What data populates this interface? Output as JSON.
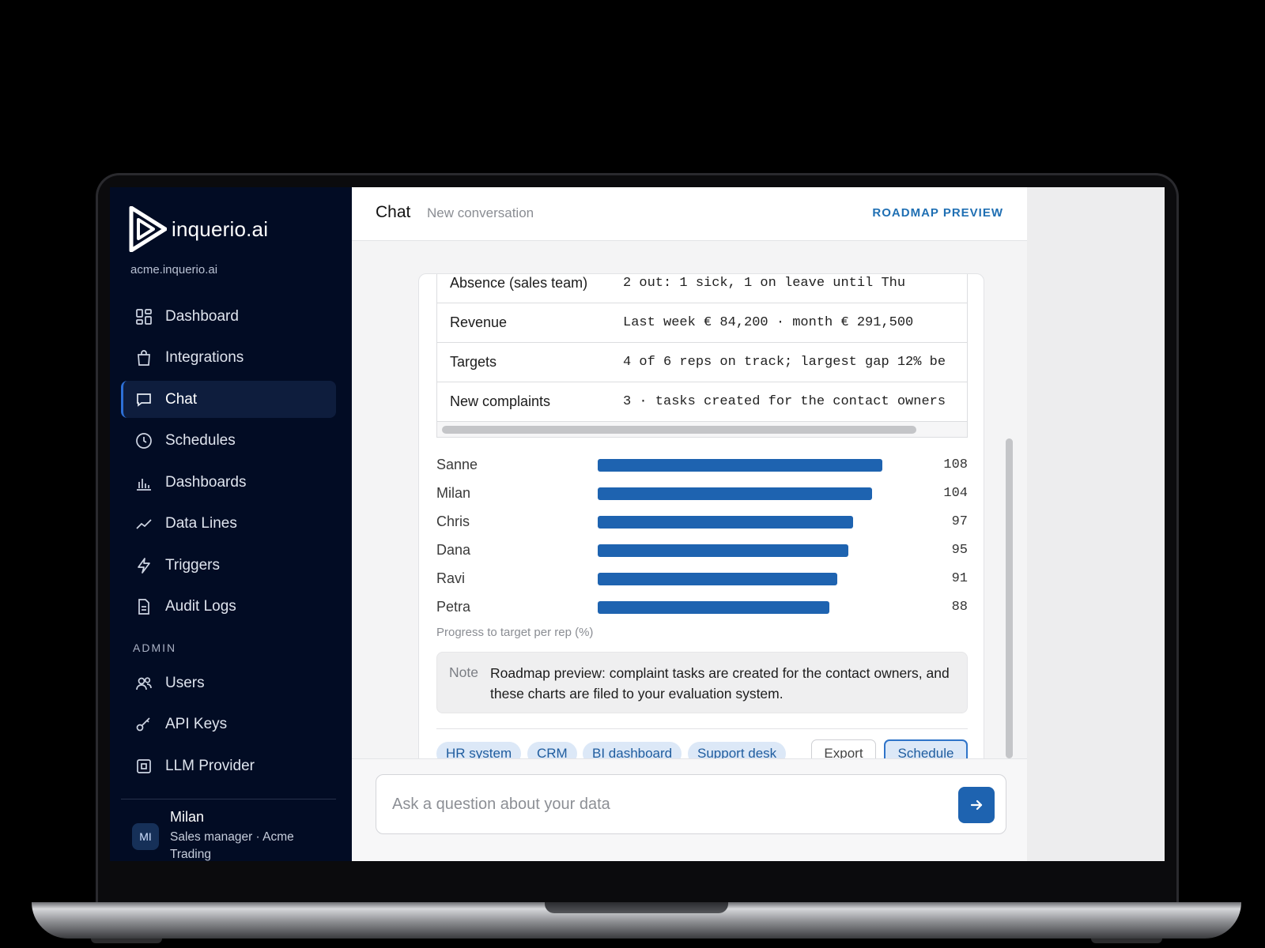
{
  "app": {
    "brand": "inquerio.ai",
    "workspace": "acme.inquerio.ai"
  },
  "sidebar": {
    "items": [
      {
        "label": "Dashboard",
        "icon": "grid-icon"
      },
      {
        "label": "Integrations",
        "icon": "shopping-bag-icon"
      },
      {
        "label": "Chat",
        "icon": "chat-bubble-icon",
        "active": true
      },
      {
        "label": "Schedules",
        "icon": "clock-icon"
      },
      {
        "label": "Dashboards",
        "icon": "bar-chart-icon"
      },
      {
        "label": "Data Lines",
        "icon": "trend-line-icon"
      },
      {
        "label": "Triggers",
        "icon": "lightning-icon"
      },
      {
        "label": "Audit Logs",
        "icon": "document-icon"
      }
    ],
    "admin_label": "ADMIN",
    "admin_items": [
      {
        "label": "Users",
        "icon": "users-icon"
      },
      {
        "label": "API Keys",
        "icon": "key-icon"
      },
      {
        "label": "LLM Provider",
        "icon": "chip-icon"
      }
    ],
    "user": {
      "initials": "MI",
      "name": "Milan",
      "role": "Sales manager · Acme Trading"
    }
  },
  "header": {
    "title": "Chat",
    "subtitle": "New conversation",
    "badge": "ROADMAP PREVIEW"
  },
  "summary_table": [
    {
      "key": "Absence (sales team)",
      "value": "2 out: 1 sick, 1 on leave until Thu"
    },
    {
      "key": "Revenue",
      "value": "Last week € 84,200 · month € 291,500"
    },
    {
      "key": "Targets",
      "value": "4 of 6 reps on track; largest gap 12% be"
    },
    {
      "key": "New complaints",
      "value": "3 · tasks created for the contact owners"
    }
  ],
  "chart_data": {
    "type": "bar",
    "orientation": "horizontal",
    "categories": [
      "Sanne",
      "Milan",
      "Chris",
      "Dana",
      "Ravi",
      "Petra"
    ],
    "values": [
      108,
      104,
      97,
      95,
      91,
      88
    ],
    "caption": "Progress to target per rep (%)",
    "xlim": [
      0,
      120
    ],
    "color": "#1e63b0"
  },
  "note": {
    "label": "Note",
    "text": "Roadmap preview: complaint tasks are created for the contact owners, and these charts are filed to your evaluation system."
  },
  "chips": [
    "HR system",
    "CRM",
    "BI dashboard",
    "Support desk"
  ],
  "actions": {
    "export": "Export",
    "schedule": "Schedule"
  },
  "composer": {
    "placeholder": "Ask a question about your data"
  }
}
